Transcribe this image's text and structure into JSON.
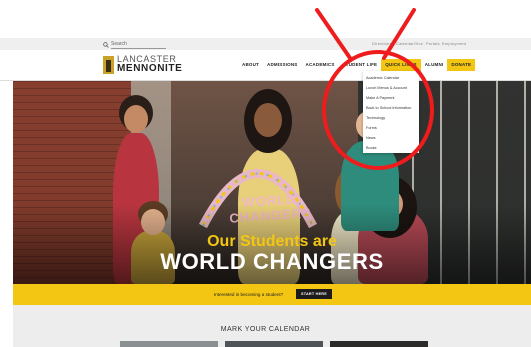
{
  "utility": {
    "search_placeholder": "Search",
    "links": [
      "Directions",
      "Calendar",
      "Give",
      "Portals",
      "Employment"
    ]
  },
  "logo": {
    "line1": "LANCASTER",
    "line2": "MENNONITE"
  },
  "nav": {
    "items": [
      {
        "label": "ABOUT"
      },
      {
        "label": "ADMISSIONS"
      },
      {
        "label": "ACADEMICS"
      },
      {
        "label": "STUDENT LIFE"
      },
      {
        "label": "QUICK LINKS"
      },
      {
        "label": "ALUMNI"
      },
      {
        "label": "DONATE"
      }
    ],
    "active": "QUICK LINKS"
  },
  "quick_links": {
    "items": [
      "Academic Calendar",
      "Lunch Menus & Account",
      "Make A Payment",
      "Back to School Information",
      "Technology",
      "Forms",
      "News",
      "Books"
    ]
  },
  "hero": {
    "tagline_top": "Our Students are",
    "tagline_bottom": "WORLD CHANGERS",
    "sign_text": "WORLD CHANGERS"
  },
  "cta": {
    "text": "Interested in becoming a student?",
    "button": "START HERE"
  },
  "calendar": {
    "title": "MARK YOUR CALENDAR"
  },
  "colors": {
    "accent": "#f3c614",
    "annotation": "#ee1c1c"
  }
}
